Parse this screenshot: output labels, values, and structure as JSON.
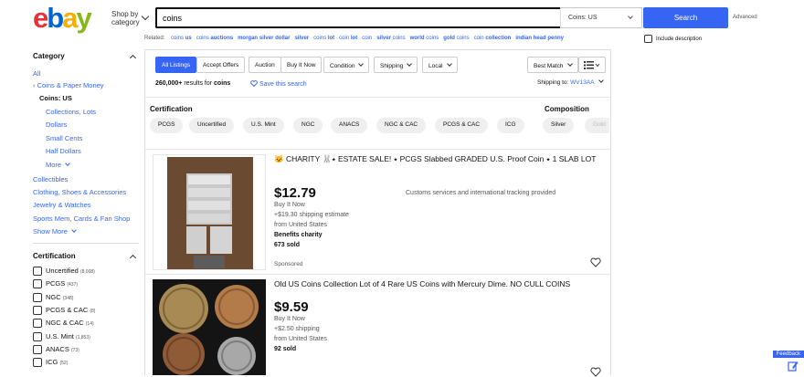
{
  "header": {
    "logo_letters": [
      "e",
      "b",
      "a",
      "y"
    ],
    "shop_by_line1": "Shop by",
    "shop_by_line2": "category",
    "search_value": "coins",
    "category_select": "Coins: US",
    "search_button": "Search",
    "advanced": "Advanced"
  },
  "related": {
    "label": "Related:",
    "items": [
      {
        "pre": "coins ",
        "bold": "us"
      },
      {
        "pre": "coins ",
        "bold": "auctions"
      },
      {
        "pre": "",
        "bold": "morgan silver dollar"
      },
      {
        "pre": "",
        "bold": "silver"
      },
      {
        "pre": "coins ",
        "bold": "lot"
      },
      {
        "pre": "coin ",
        "bold": "lot"
      },
      {
        "pre": "coin",
        "bold": ""
      },
      {
        "pre": "",
        "bold": "silver",
        "post": " coins"
      },
      {
        "pre": "",
        "bold": "world",
        "post": " coins"
      },
      {
        "pre": "",
        "bold": "gold",
        "post": " coins"
      },
      {
        "pre": "coin ",
        "bold": "collection"
      },
      {
        "pre": "",
        "bold": "indian head penny"
      }
    ],
    "include_description": "Include description"
  },
  "sidebar": {
    "category_heading": "Category",
    "all": "All",
    "coins_paper_money": "Coins & Paper Money",
    "coins_us": "Coins: US",
    "sub_items": [
      "Collections, Lots",
      "Dollars",
      "Small Cents",
      "Half Dollars"
    ],
    "more": "More",
    "other_cats": [
      "Collectibles",
      "Clothing, Shoes & Accessories",
      "Jewelry & Watches",
      "Sports Mem, Cards & Fan Shop"
    ],
    "show_more": "Show More",
    "certification_heading": "Certification",
    "cert_items": [
      {
        "label": "Uncertified",
        "count": "(8,008)"
      },
      {
        "label": "PCGS",
        "count": "(437)"
      },
      {
        "label": "NGC",
        "count": "(348)"
      },
      {
        "label": "PCGS & CAC",
        "count": "(8)"
      },
      {
        "label": "NGC & CAC",
        "count": "(14)"
      },
      {
        "label": "U.S. Mint",
        "count": "(1,853)"
      },
      {
        "label": "ANACS",
        "count": "(73)"
      },
      {
        "label": "ICG",
        "count": "(52)"
      }
    ]
  },
  "toolbar": {
    "buttons": [
      "All Listings",
      "Accept Offers",
      "Auction",
      "Buy It Now"
    ],
    "dropdowns": [
      "Condition",
      "Shipping",
      "Local"
    ],
    "sort": "Best Match",
    "results_count": "260,000+",
    "results_mid": " results for ",
    "results_query": "coins",
    "save_search": "Save this search",
    "ship_to_label": "Shipping to:",
    "ship_to_value": "WV13AA"
  },
  "refine": {
    "cert_heading": "Certification",
    "comp_heading": "Composition",
    "cert_chips": [
      "PCGS",
      "Uncertified",
      "U.S. Mint",
      "NGC",
      "ANACS",
      "NGC & CAC",
      "PCGS & CAC",
      "ICG"
    ],
    "comp_chips": [
      "Silver",
      "Gold"
    ]
  },
  "listings": [
    {
      "title": "🐱 CHARITY 🐰⭑ ESTATE SALE! ⭑ PCGS Slabbed GRADED U.S. Proof Coin ⭑ 1 SLAB LOT",
      "price": "$12.79",
      "format": "Buy It Now",
      "shipping": "+$19.30 shipping estimate",
      "location": "from United States",
      "extra": "Benefits charity",
      "sold": "673 sold",
      "note": "Customs services and international tracking provided",
      "sponsored": "Sponsored"
    },
    {
      "title": "Old US Coins Collection Lot of 4 Rare US Coins with Mercury Dime. NO CULL COINS",
      "price": "$9.59",
      "format": "Buy It Now",
      "shipping": "+$2.50 shipping",
      "location": "from United States",
      "sold": "92 sold"
    }
  ],
  "feedback": "Feedback",
  "colors": {
    "accent": "#3665f3",
    "logo_red": "#e53238",
    "logo_blue": "#0064d2",
    "logo_yellow": "#f5af02",
    "logo_green": "#86b817"
  }
}
